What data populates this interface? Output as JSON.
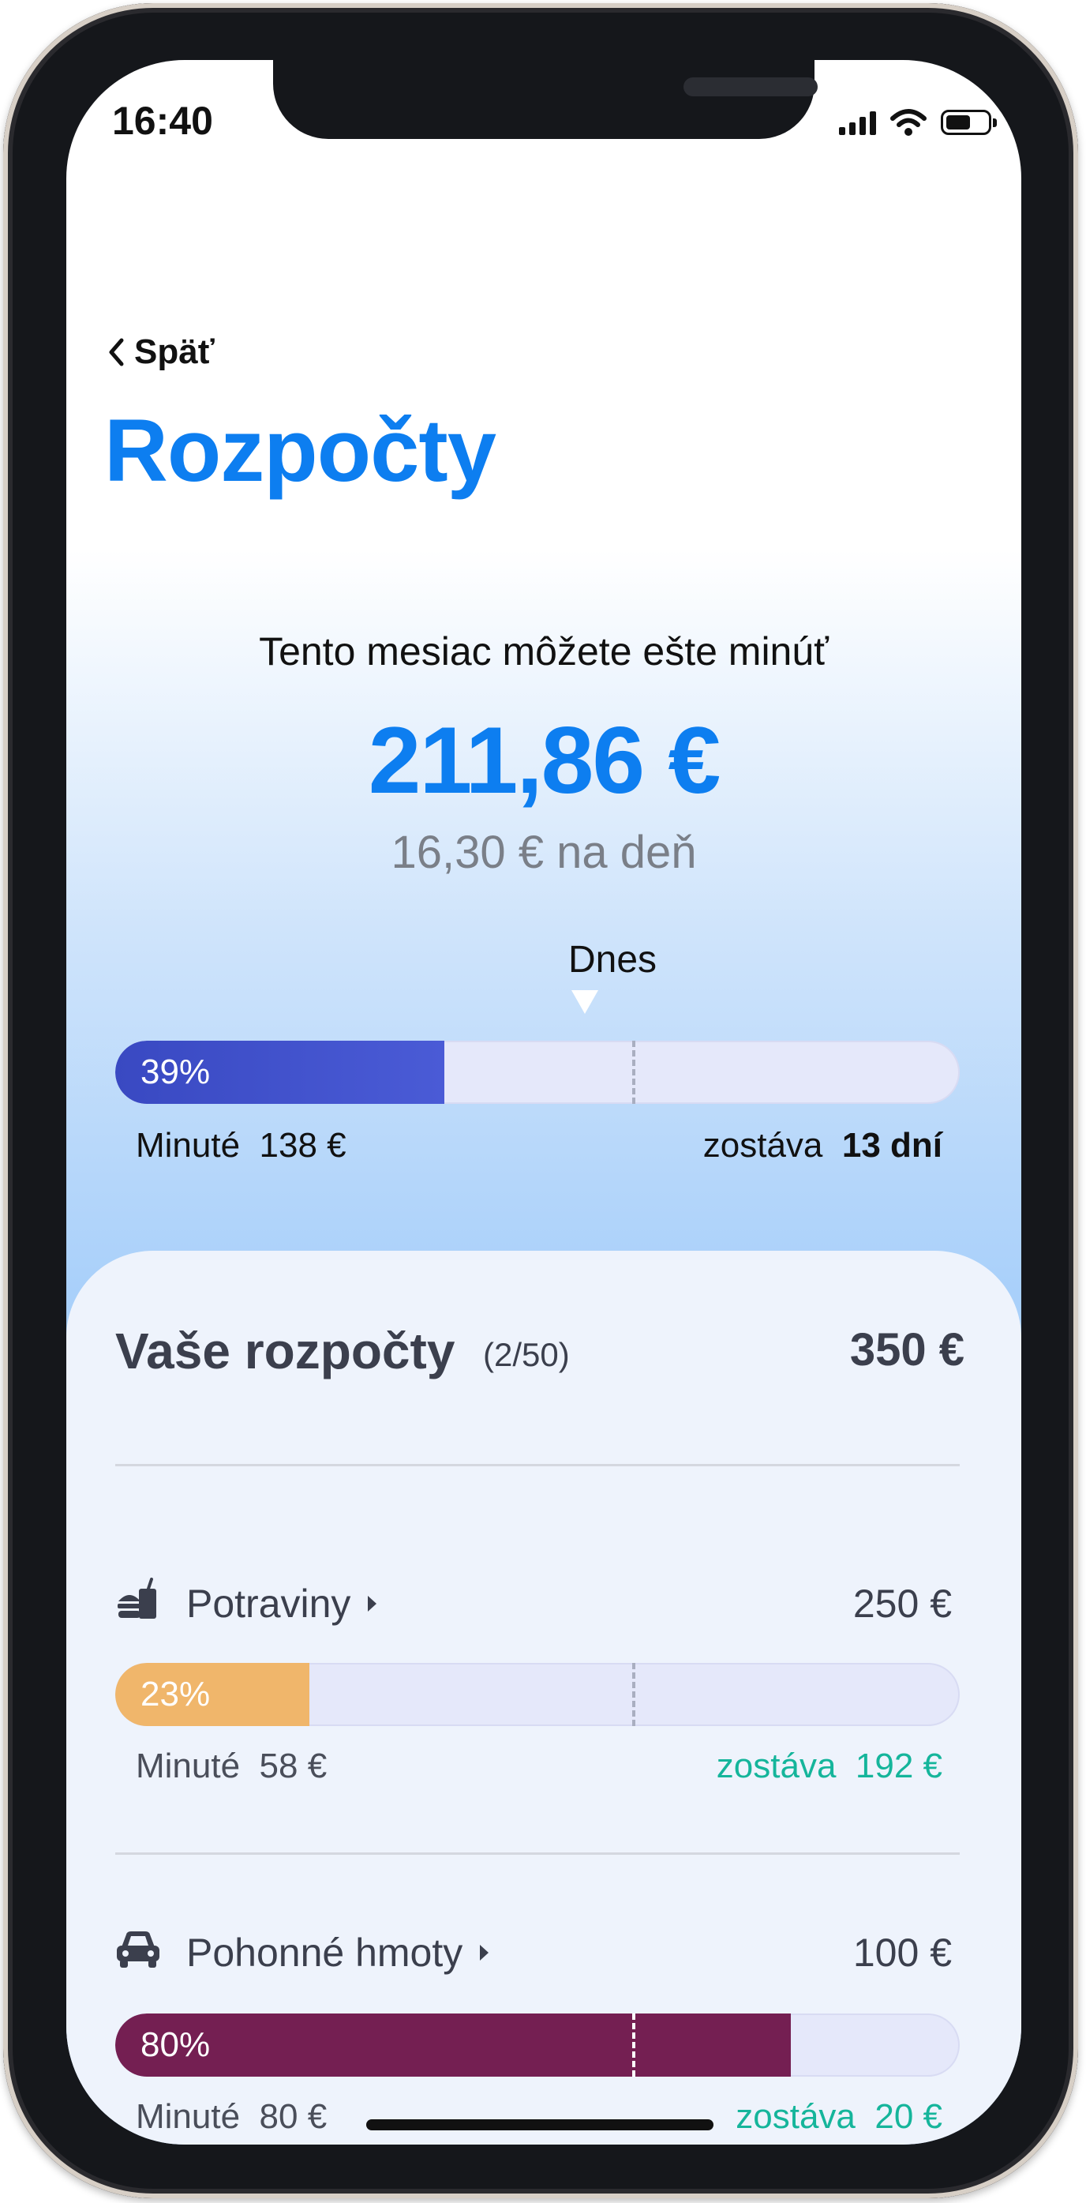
{
  "status_bar": {
    "time": "16:40"
  },
  "nav": {
    "back_label": "Späť"
  },
  "page": {
    "title": "Rozpočty"
  },
  "summary": {
    "subtitle": "Tento mesiac môžete ešte minúť",
    "amount": "211,86 €",
    "per_day": "16,30 € na deň",
    "today_label": "Dnes",
    "progress_percent": 39,
    "progress_label": "39%",
    "spent_label": "Minuté",
    "spent_value": "138 €",
    "remaining_label": "zostáva",
    "remaining_value": "13 dní",
    "fill_color": "#3e4ec9"
  },
  "budgets": {
    "title": "Vaše rozpočty",
    "count": "(2/50)",
    "total": "350 €",
    "items": [
      {
        "name": "Potraviny",
        "icon": "food-drink-icon",
        "amount": "250 €",
        "progress_percent": 23,
        "progress_label": "23%",
        "spent_label": "Minuté",
        "spent_value": "58 €",
        "remaining_label": "zostáva",
        "remaining_value": "192 €",
        "color": "#f0b66b"
      },
      {
        "name": "Pohonné hmoty",
        "icon": "car-icon",
        "amount": "100 €",
        "progress_percent": 80,
        "progress_label": "80%",
        "spent_label": "Minuté",
        "spent_value": "80 €",
        "remaining_label": "zostáva",
        "remaining_value": "20 €",
        "color": "#741f52"
      }
    ]
  }
}
